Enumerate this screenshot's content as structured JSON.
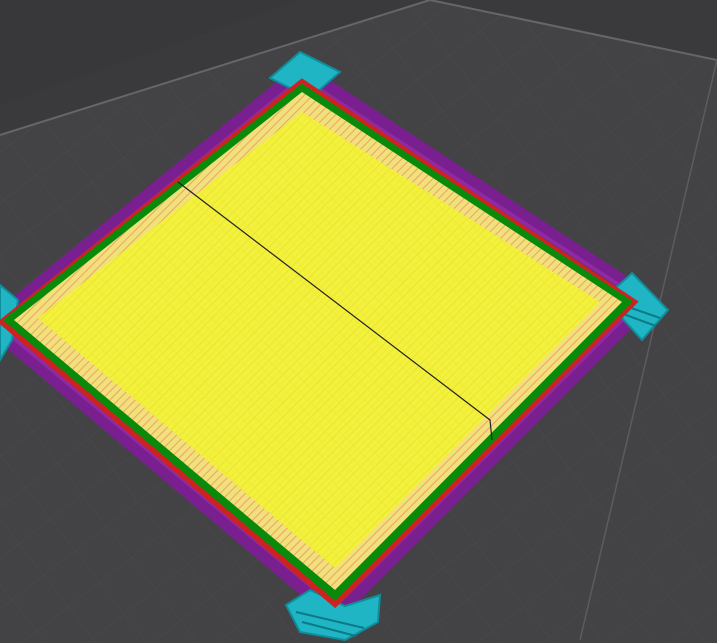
{
  "viewport": {
    "label": "",
    "background_color": "#3a3a3d",
    "bed_color": "#434346",
    "bed_grid_color": "#4e4e52",
    "bed_edge_color": "#6a6a6e"
  },
  "toolpaths": {
    "colors": {
      "skirt_brim": "#7a1f8f",
      "external_perimeter": "#cc2222",
      "perimeter_outer": "#0a8a0a",
      "top_solid_infill": "#f2f23a",
      "overhang_infill": "#e8b87a",
      "support_tabs": "#1fb5c4",
      "travel_line": "#222222"
    },
    "features": [
      "skirt-brim",
      "external-perimeter",
      "perimeter",
      "solid-infill",
      "top-solid-infill",
      "support-tab",
      "travel"
    ],
    "tab_count": 4
  }
}
